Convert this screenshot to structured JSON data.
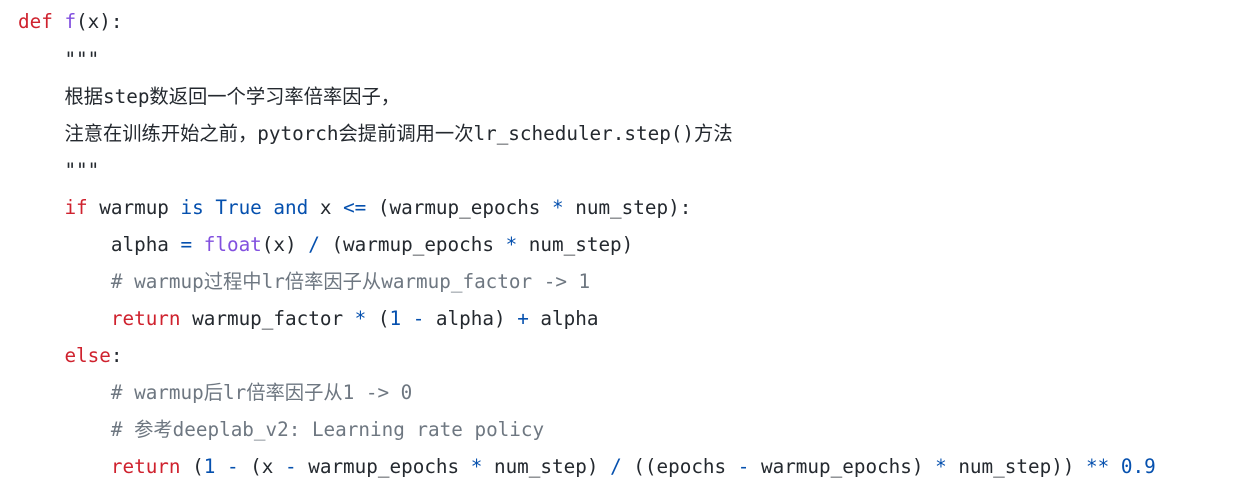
{
  "code": {
    "lines": [
      [
        {
          "t": "def",
          "c": "kw"
        },
        {
          "t": " ",
          "c": "plain"
        },
        {
          "t": "f",
          "c": "fn"
        },
        {
          "t": "(x):",
          "c": "plain"
        }
      ],
      [
        {
          "t": "    ",
          "c": "plain"
        },
        {
          "t": "\"\"\"",
          "c": "str"
        }
      ],
      [
        {
          "t": "    ",
          "c": "plain"
        },
        {
          "t": "根据step数返回一个学习率倍率因子，",
          "c": "doc"
        }
      ],
      [
        {
          "t": "    ",
          "c": "plain"
        },
        {
          "t": "注意在训练开始之前，pytorch会提前调用一次lr_scheduler.step()方法",
          "c": "doc"
        }
      ],
      [
        {
          "t": "    ",
          "c": "plain"
        },
        {
          "t": "\"\"\"",
          "c": "str"
        }
      ],
      [
        {
          "t": "    ",
          "c": "plain"
        },
        {
          "t": "if",
          "c": "kw"
        },
        {
          "t": " warmup ",
          "c": "plain"
        },
        {
          "t": "is",
          "c": "kw2"
        },
        {
          "t": " ",
          "c": "plain"
        },
        {
          "t": "True",
          "c": "kw2"
        },
        {
          "t": " ",
          "c": "plain"
        },
        {
          "t": "and",
          "c": "kw2"
        },
        {
          "t": " x ",
          "c": "plain"
        },
        {
          "t": "<=",
          "c": "op"
        },
        {
          "t": " (warmup_epochs ",
          "c": "plain"
        },
        {
          "t": "*",
          "c": "op"
        },
        {
          "t": " num_step):",
          "c": "plain"
        }
      ],
      [
        {
          "t": "        alpha ",
          "c": "plain"
        },
        {
          "t": "=",
          "c": "op"
        },
        {
          "t": " ",
          "c": "plain"
        },
        {
          "t": "float",
          "c": "fn"
        },
        {
          "t": "(x) ",
          "c": "plain"
        },
        {
          "t": "/",
          "c": "op"
        },
        {
          "t": " (warmup_epochs ",
          "c": "plain"
        },
        {
          "t": "*",
          "c": "op"
        },
        {
          "t": " num_step)",
          "c": "plain"
        }
      ],
      [
        {
          "t": "        ",
          "c": "plain"
        },
        {
          "t": "# warmup过程中lr倍率因子从warmup_factor -> 1",
          "c": "cm"
        }
      ],
      [
        {
          "t": "        ",
          "c": "plain"
        },
        {
          "t": "return",
          "c": "kw"
        },
        {
          "t": " warmup_factor ",
          "c": "plain"
        },
        {
          "t": "*",
          "c": "op"
        },
        {
          "t": " (",
          "c": "plain"
        },
        {
          "t": "1",
          "c": "num"
        },
        {
          "t": " ",
          "c": "plain"
        },
        {
          "t": "-",
          "c": "op"
        },
        {
          "t": " alpha) ",
          "c": "plain"
        },
        {
          "t": "+",
          "c": "op"
        },
        {
          "t": " alpha",
          "c": "plain"
        }
      ],
      [
        {
          "t": "    ",
          "c": "plain"
        },
        {
          "t": "else",
          "c": "kw"
        },
        {
          "t": ":",
          "c": "plain"
        }
      ],
      [
        {
          "t": "        ",
          "c": "plain"
        },
        {
          "t": "# warmup后lr倍率因子从1 -> 0",
          "c": "cm"
        }
      ],
      [
        {
          "t": "        ",
          "c": "plain"
        },
        {
          "t": "# 参考deeplab_v2: Learning rate policy",
          "c": "cm"
        }
      ],
      [
        {
          "t": "        ",
          "c": "plain"
        },
        {
          "t": "return",
          "c": "kw"
        },
        {
          "t": " (",
          "c": "plain"
        },
        {
          "t": "1",
          "c": "num"
        },
        {
          "t": " ",
          "c": "plain"
        },
        {
          "t": "-",
          "c": "op"
        },
        {
          "t": " (x ",
          "c": "plain"
        },
        {
          "t": "-",
          "c": "op"
        },
        {
          "t": " warmup_epochs ",
          "c": "plain"
        },
        {
          "t": "*",
          "c": "op"
        },
        {
          "t": " num_step) ",
          "c": "plain"
        },
        {
          "t": "/",
          "c": "op"
        },
        {
          "t": " ((epochs ",
          "c": "plain"
        },
        {
          "t": "-",
          "c": "op"
        },
        {
          "t": " warmup_epochs) ",
          "c": "plain"
        },
        {
          "t": "*",
          "c": "op"
        },
        {
          "t": " num_step)) ",
          "c": "plain"
        },
        {
          "t": "**",
          "c": "op"
        },
        {
          "t": " ",
          "c": "plain"
        },
        {
          "t": "0.9",
          "c": "num"
        }
      ]
    ]
  }
}
